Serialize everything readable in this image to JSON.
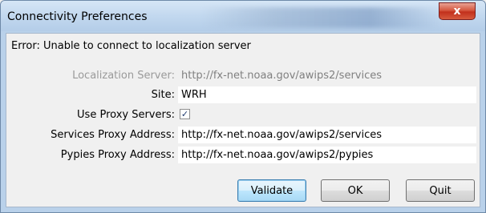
{
  "window": {
    "title": "Connectivity Preferences",
    "close_glyph": "x"
  },
  "error": {
    "message": "Error: Unable to connect to localization server"
  },
  "form": {
    "localization_server": {
      "label": "Localization Server:",
      "value": "http://fx-net.noaa.gov/awips2/services",
      "enabled": false
    },
    "site": {
      "label": "Site:",
      "value": "WRH"
    },
    "use_proxy": {
      "label": "Use Proxy Servers:",
      "checked": true,
      "check_glyph": "✓"
    },
    "services_proxy": {
      "label": "Services Proxy Address:",
      "value": "http://fx-net.noaa.gov/awips2/services"
    },
    "pypies_proxy": {
      "label": "Pypies Proxy Address:",
      "value": "http://fx-net.noaa.gov/awips2/pypies"
    }
  },
  "buttons": {
    "validate": "Validate",
    "ok": "OK",
    "quit": "Quit"
  },
  "colors": {
    "title_bar": "#c2d8ef",
    "close_button": "#c2301c",
    "default_button_border": "#3c7fb1"
  }
}
